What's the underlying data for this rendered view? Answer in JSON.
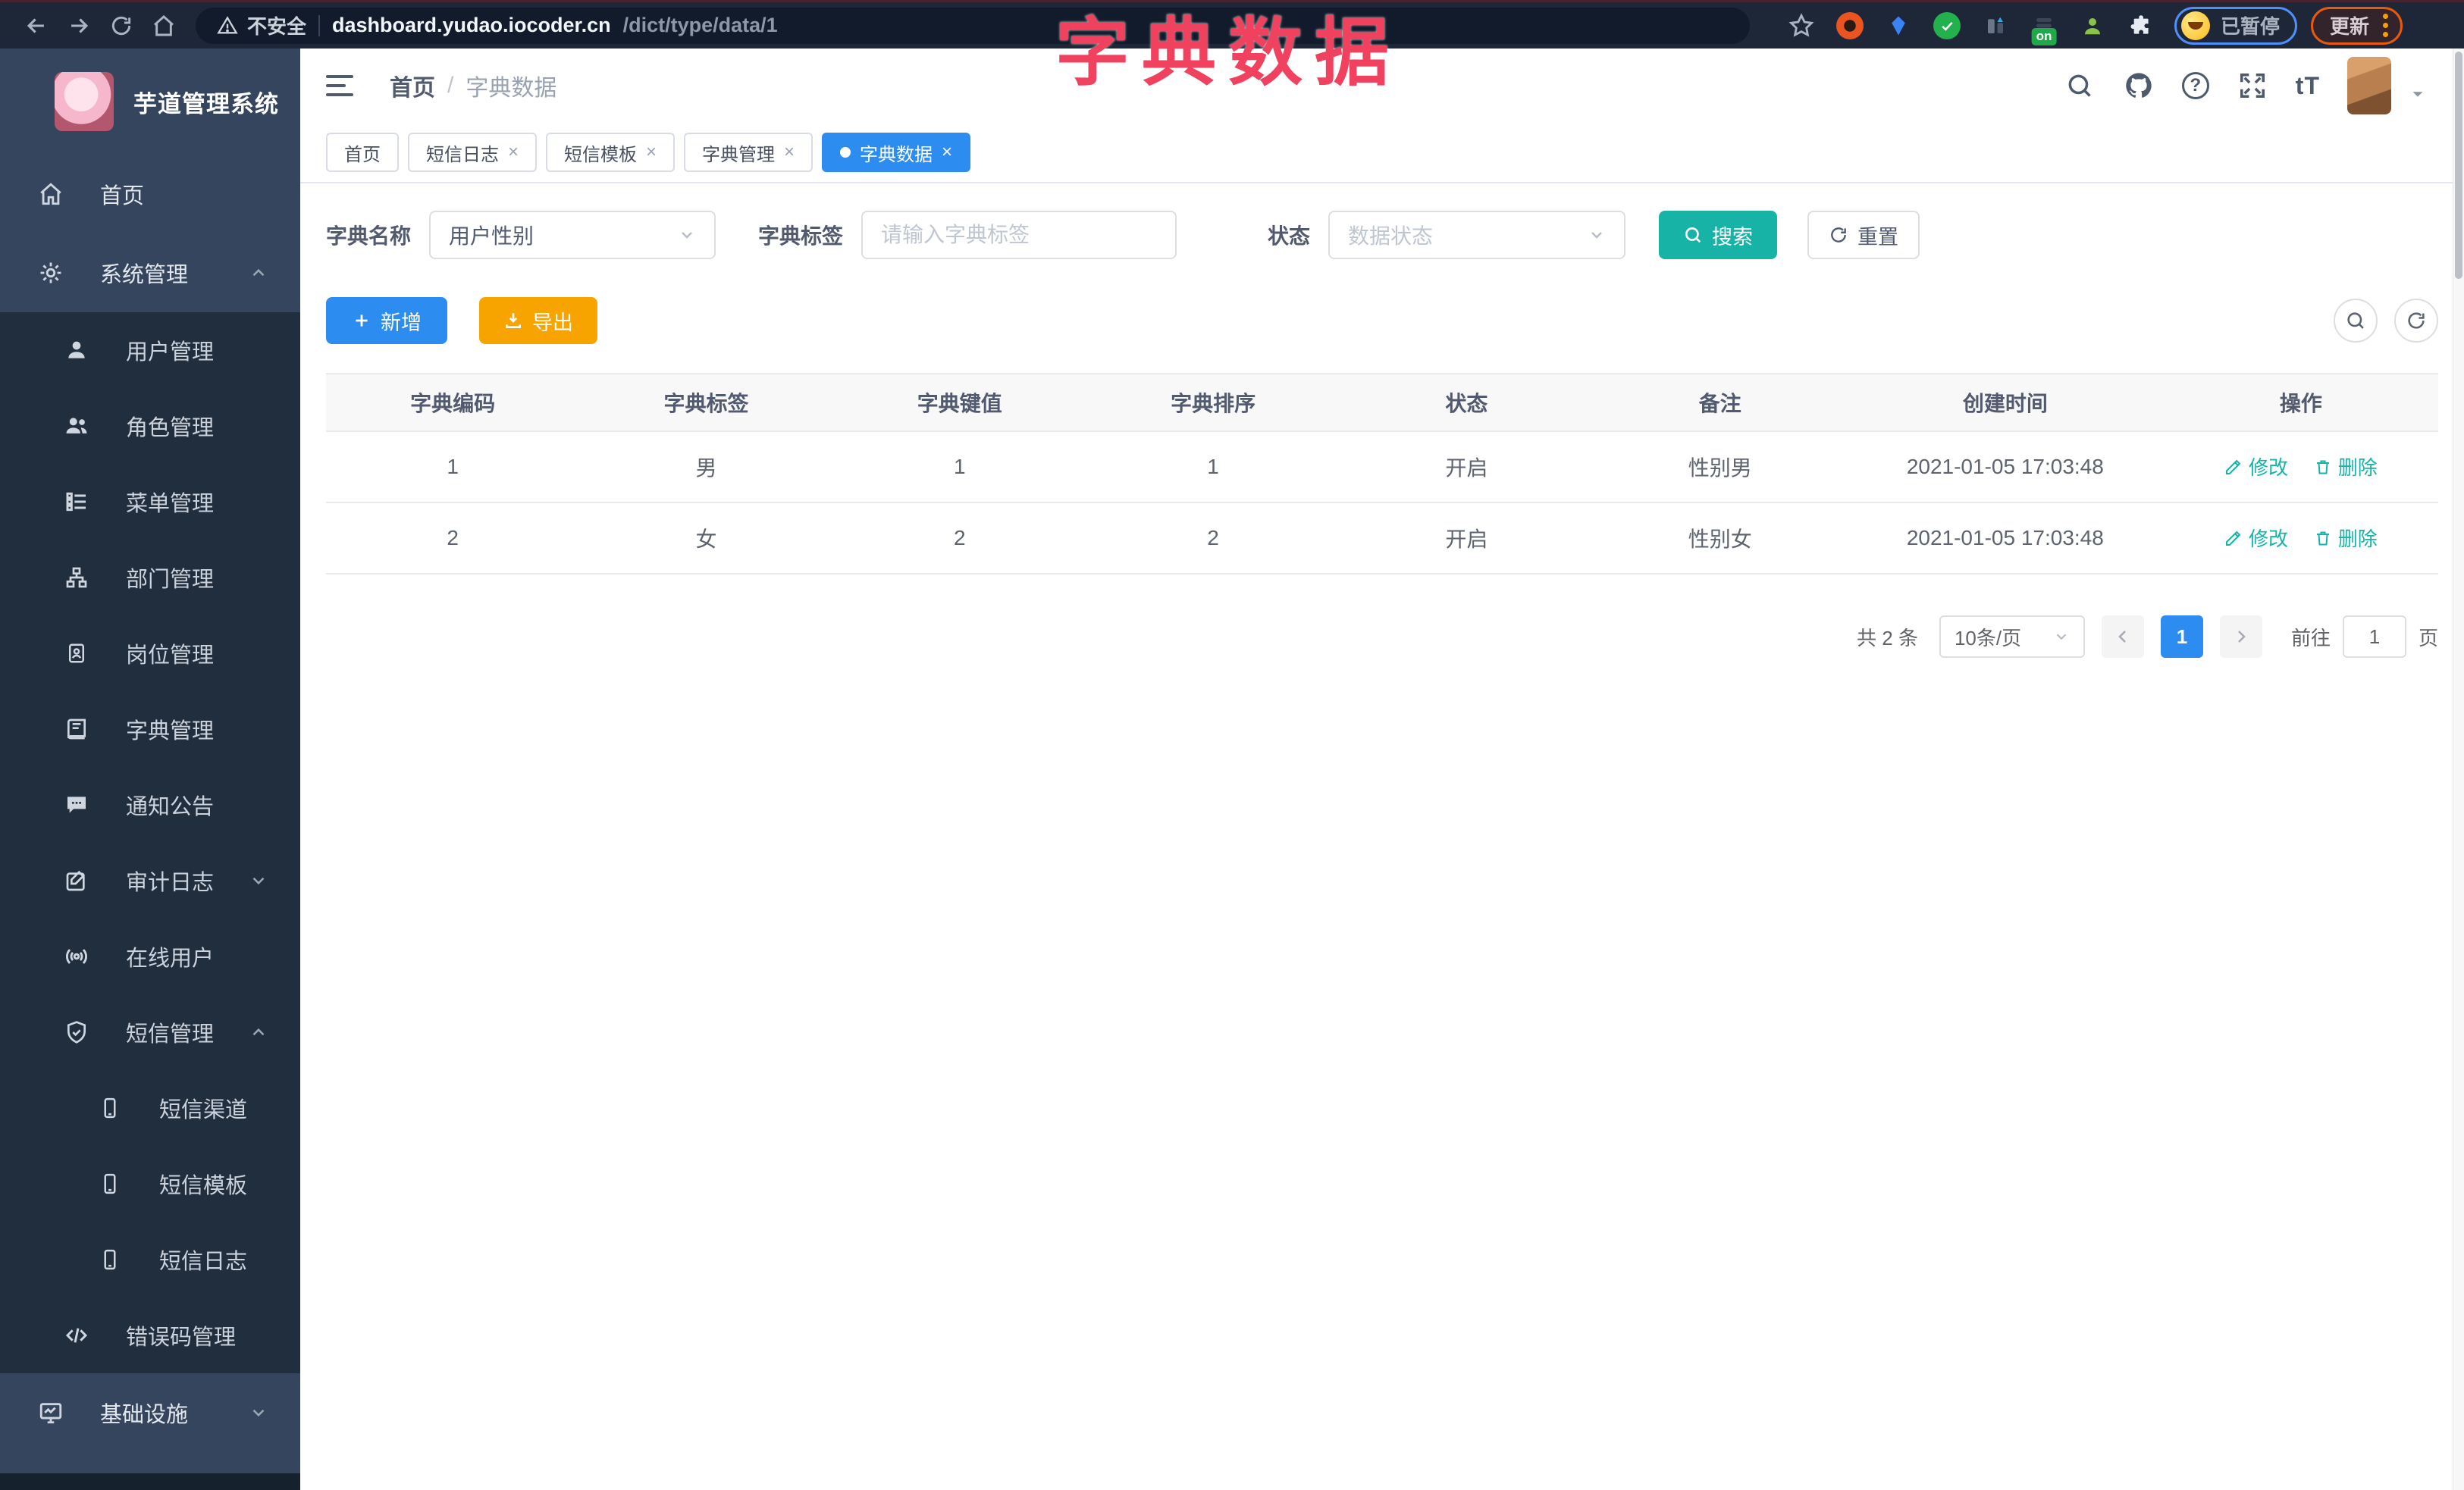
{
  "browser": {
    "security_label": "不安全",
    "url_host": "dashboard.yudao.iocoder.cn",
    "url_path": "/dict/type/data/1",
    "extension_badge": "on",
    "profile_status": "已暂停",
    "update_label": "更新"
  },
  "annotation": {
    "text": "字典数据"
  },
  "sidebar": {
    "title": "芋道管理系统",
    "items": [
      {
        "label": "首页"
      },
      {
        "label": "系统管理"
      },
      {
        "label": "用户管理"
      },
      {
        "label": "角色管理"
      },
      {
        "label": "菜单管理"
      },
      {
        "label": "部门管理"
      },
      {
        "label": "岗位管理"
      },
      {
        "label": "字典管理"
      },
      {
        "label": "通知公告"
      },
      {
        "label": "审计日志"
      },
      {
        "label": "在线用户"
      },
      {
        "label": "短信管理"
      },
      {
        "label": "短信渠道"
      },
      {
        "label": "短信模板"
      },
      {
        "label": "短信日志"
      },
      {
        "label": "错误码管理"
      },
      {
        "label": "基础设施"
      }
    ]
  },
  "header": {
    "breadcrumb": {
      "home": "首页",
      "separator": "/",
      "current": "字典数据"
    },
    "help_glyph": "?",
    "font_size_label": "tT"
  },
  "tabs": {
    "close_glyph": "×",
    "items": [
      {
        "label": "首页"
      },
      {
        "label": "短信日志"
      },
      {
        "label": "短信模板"
      },
      {
        "label": "字典管理"
      },
      {
        "label": "字典数据"
      }
    ]
  },
  "filters": {
    "name_label": "字典名称",
    "name_value": "用户性别",
    "label_label": "字典标签",
    "label_placeholder": "请输入字典标签",
    "status_label": "状态",
    "status_placeholder": "数据状态",
    "search_label": "搜索",
    "reset_label": "重置"
  },
  "toolbar": {
    "add_label": "新增",
    "export_label": "导出"
  },
  "table": {
    "columns": [
      "字典编码",
      "字典标签",
      "字典键值",
      "字典排序",
      "状态",
      "备注",
      "创建时间",
      "操作"
    ],
    "actions": {
      "edit": "修改",
      "delete": "删除"
    },
    "rows": [
      {
        "code": "1",
        "label": "男",
        "value": "1",
        "sort": "1",
        "status": "开启",
        "remark": "性别男",
        "created": "2021-01-05 17:03:48"
      },
      {
        "code": "2",
        "label": "女",
        "value": "2",
        "sort": "2",
        "status": "开启",
        "remark": "性别女",
        "created": "2021-01-05 17:03:48"
      }
    ]
  },
  "pagination": {
    "total": "共 2 条",
    "page_size": "10条/页",
    "current": "1",
    "goto_label": "前往",
    "goto_value": "1",
    "unit": "页"
  },
  "colors": {
    "primary_blue": "#2d8cf0",
    "theme_teal": "#17b3a6",
    "export_orange": "#f7a400",
    "annotation_pink": "#f0415f",
    "sidebar_bg": "#36455e",
    "sidebar_submenu_bg": "#202e3e",
    "browser_bg": "#1d2737"
  }
}
